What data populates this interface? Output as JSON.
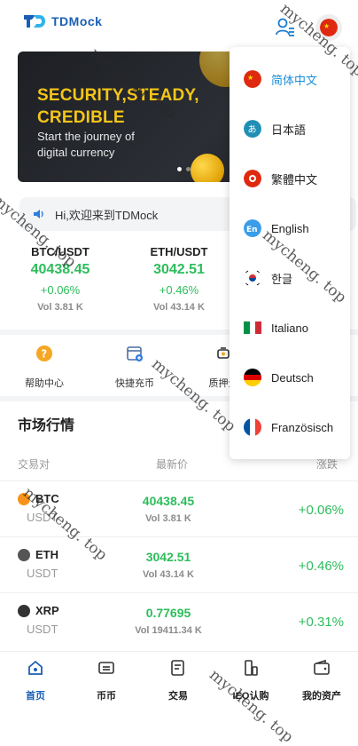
{
  "header": {
    "logo_text": "TDMock",
    "user_icon": "user-list-icon",
    "lang_icon": "flag-cn-icon"
  },
  "banner": {
    "title_line1": "SECURITY,STEADY,",
    "title_line2": "CREDIBLE",
    "sub_line1": "Start the journey of",
    "sub_line2": "digital currency"
  },
  "notice": {
    "text": "Hi,欢迎来到TDMock"
  },
  "tickers": [
    {
      "pair": "BTC/USDT",
      "price": "40438.45",
      "change": "+0.06%",
      "volume": "Vol 3.81 K"
    },
    {
      "pair": "ETH/USDT",
      "price": "3042.51",
      "change": "+0.46%",
      "volume": "Vol 43.14 K"
    }
  ],
  "quick_actions": [
    {
      "label": "帮助中心",
      "icon": "help-icon"
    },
    {
      "label": "快捷充币",
      "icon": "deposit-icon"
    },
    {
      "label": "质押生",
      "icon": "staking-icon"
    }
  ],
  "market": {
    "title": "市场行情",
    "headers": {
      "pair": "交易对",
      "price": "最新价",
      "change": "涨跌"
    },
    "rows": [
      {
        "symbol": "BTC",
        "quote": "USDT",
        "price": "40438.45",
        "volume": "Vol 3.81 K",
        "change": "+0.06%",
        "icon": "btc-icon",
        "color": "#f7931a"
      },
      {
        "symbol": "ETH",
        "quote": "USDT",
        "price": "3042.51",
        "volume": "Vol 43.14 K",
        "change": "+0.46%",
        "icon": "eth-icon",
        "color": "#555555"
      },
      {
        "symbol": "XRP",
        "quote": "USDT",
        "price": "0.77695",
        "volume": "Vol 19411.34 K",
        "change": "+0.31%",
        "icon": "xrp-icon",
        "color": "#333333"
      }
    ]
  },
  "tabbar": [
    {
      "label": "首页",
      "icon": "home-icon",
      "active": true
    },
    {
      "label": "币币",
      "icon": "swap-icon",
      "active": false
    },
    {
      "label": "交易",
      "icon": "trade-icon",
      "active": false
    },
    {
      "label": "IEO认购",
      "icon": "ieo-icon",
      "active": false
    },
    {
      "label": "我的资产",
      "icon": "wallet-icon",
      "active": false
    }
  ],
  "languages": [
    {
      "label": "简体中文",
      "flag": "cn",
      "active": true
    },
    {
      "label": "日本語",
      "flag": "jp-hiragana",
      "active": false
    },
    {
      "label": "繁體中文",
      "flag": "hk",
      "active": false
    },
    {
      "label": "English",
      "flag": "en",
      "active": false
    },
    {
      "label": "한글",
      "flag": "kr",
      "active": false
    },
    {
      "label": "Italiano",
      "flag": "it",
      "active": false
    },
    {
      "label": "Deutsch",
      "flag": "de",
      "active": false
    },
    {
      "label": "Französisch",
      "flag": "fr",
      "active": false
    }
  ],
  "colors": {
    "accent": "#1a5fb4",
    "up_green": "#2dbd5b",
    "banner_gold": "#f5c518"
  },
  "watermark": "mycheng. top"
}
